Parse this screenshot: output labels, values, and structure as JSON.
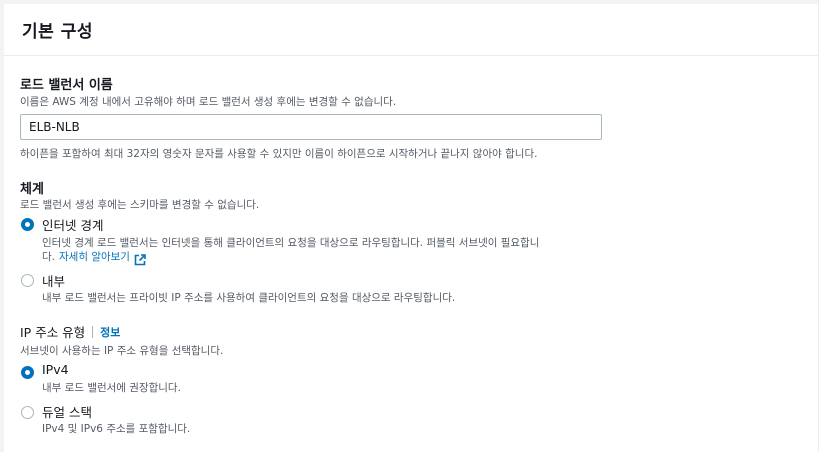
{
  "section": {
    "title": "기본 구성"
  },
  "lb_name": {
    "label": "로드 밸런서 이름",
    "description": "이름은 AWS 계정 내에서 고유해야 하며 로드 밸런서 생성 후에는 변경할 수 없습니다.",
    "value": "ELB-NLB",
    "constraint": "하이픈을 포함하여 최대 32자의 영숫자 문자를 사용할 수 있지만 이름이 하이픈으로 시작하거나 끝나지 않아야 합니다."
  },
  "scheme": {
    "label": "체계",
    "description": "로드 밸런서 생성 후에는 스키마를 변경할 수 없습니다.",
    "options": [
      {
        "label": "인터넷 경계",
        "description_line1": "인터넷 경계 로드 밸런서는 인터넷을 통해 클라이언트의 요청을 대상으로 라우팅합니다. 퍼블릭 서브넷이 필요합니",
        "description_line2": "다.",
        "learn_more": "자세히 알아보기",
        "checked": true
      },
      {
        "label": "내부",
        "description": "내부 로드 밸런서는 프라이빗 IP 주소를 사용하여 클라이언트의 요청을 대상으로 라우팅합니다.",
        "checked": false
      }
    ]
  },
  "ip_type": {
    "label": "IP 주소 유형",
    "info": "정보",
    "description": "서브넷이 사용하는 IP 주소 유형을 선택합니다.",
    "options": [
      {
        "label": "IPv4",
        "description": "내부 로드 밸런서에 권장합니다.",
        "checked": true
      },
      {
        "label": "듀얼 스택",
        "description": "IPv4 및 IPv6 주소를 포함합니다.",
        "checked": false
      }
    ]
  },
  "colors": {
    "accent": "#0073bb",
    "text": "#16191f",
    "muted": "#545b64"
  }
}
